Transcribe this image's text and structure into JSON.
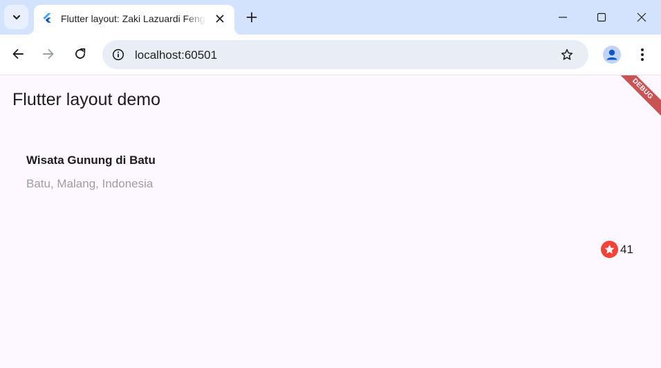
{
  "browser": {
    "tab": {
      "title": "Flutter layout: Zaki Lazuardi Fengky",
      "favicon": "flutter-logo-icon"
    },
    "omnibox": {
      "url": "localhost:60501"
    },
    "icons": {
      "tab_search": "chevron-down-icon",
      "tab_close": "close-icon",
      "new_tab": "plus-icon",
      "minimize": "minimize-icon",
      "maximize": "maximize-icon",
      "close_window": "close-icon",
      "back": "arrow-left-icon",
      "forward": "arrow-right-icon",
      "reload": "reload-icon",
      "site_info": "info-icon",
      "bookmark": "star-outline-icon",
      "profile": "person-icon",
      "menu": "more-vert-icon"
    }
  },
  "app": {
    "appbar_title": "Flutter layout demo",
    "debug_banner": "DEBUG",
    "title_section": {
      "name": "Wisata Gunung di Batu",
      "location": "Batu, Malang, Indonesia",
      "rating_count": "41"
    }
  },
  "colors": {
    "tabstrip": "#d3e3fd",
    "page_background": "#fdf7ff",
    "star": "#f44336",
    "location_text": "#9e9e9e",
    "debug_banner": "#b71c1c"
  }
}
